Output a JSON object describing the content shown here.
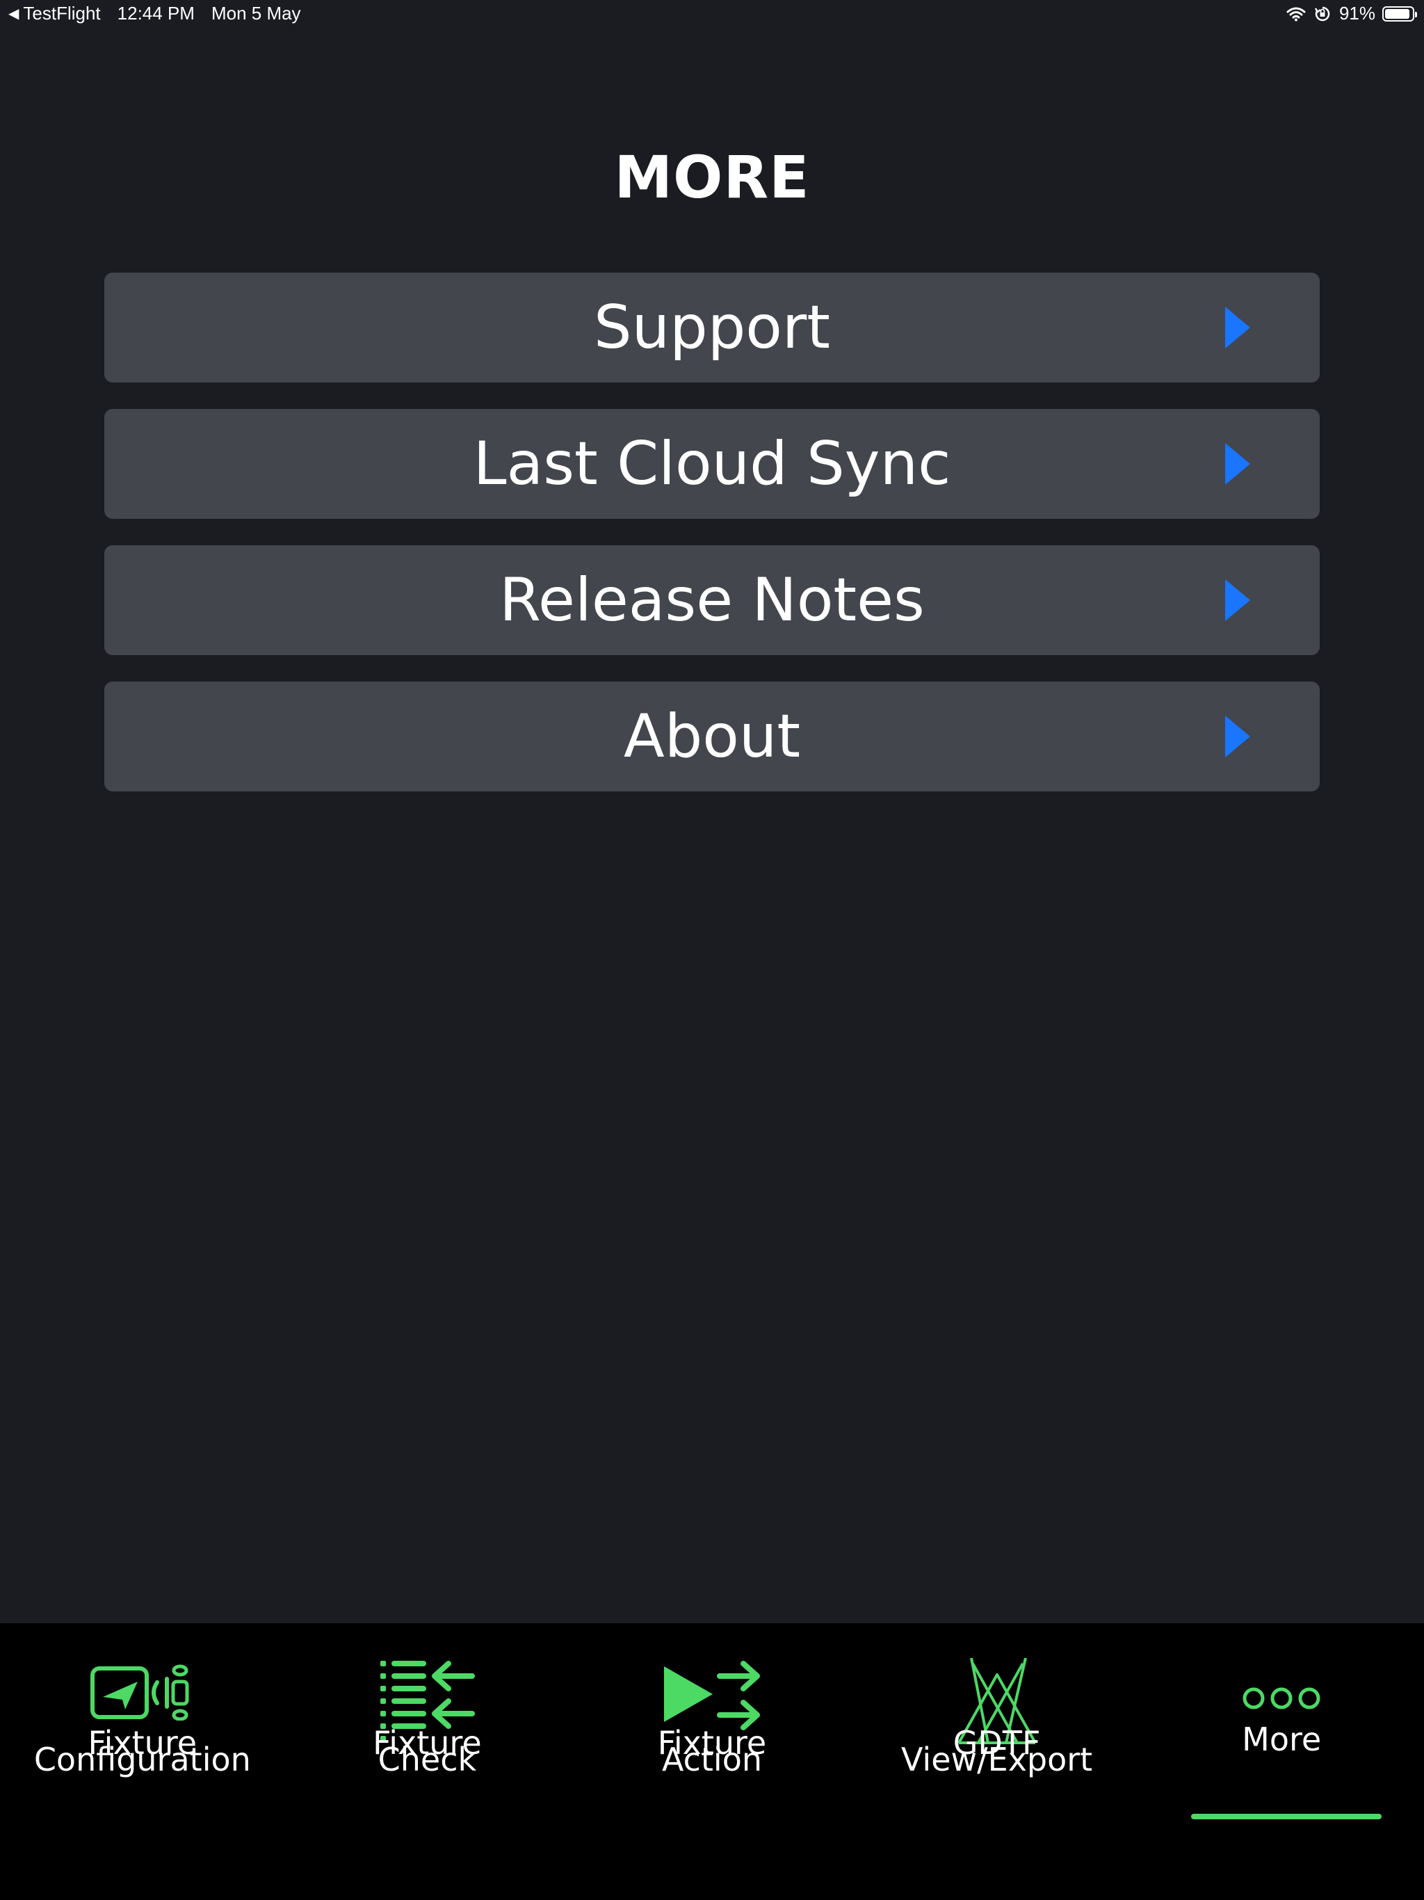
{
  "status_bar": {
    "back_app": "TestFlight",
    "time": "12:44 PM",
    "date": "Mon 5 May",
    "battery_percent": "91%",
    "battery_level": 0.91,
    "icons": [
      "wifi-icon",
      "orientation-lock-icon",
      "battery-icon"
    ]
  },
  "page": {
    "title": "MORE"
  },
  "menu": {
    "items": [
      {
        "label": "Support"
      },
      {
        "label": "Last Cloud Sync"
      },
      {
        "label": "Release Notes"
      },
      {
        "label": "About"
      }
    ]
  },
  "tab_bar": {
    "tabs": [
      {
        "label": "Fixture\nConfiguration",
        "icon": "fixture-configuration-icon"
      },
      {
        "label": "Fixture\nCheck",
        "icon": "fixture-check-icon"
      },
      {
        "label": "Fixture\nAction",
        "icon": "fixture-action-icon"
      },
      {
        "label": "GDTF\nView/Export",
        "icon": "gdtf-icon"
      },
      {
        "label": "More",
        "icon": "more-dots-icon",
        "selected": true
      }
    ]
  },
  "colors": {
    "background": "#1a1c21",
    "menu_item": "#43464d",
    "chevron": "#1a75ff",
    "accent_green": "#4cd964",
    "tab_bar": "#000000"
  }
}
